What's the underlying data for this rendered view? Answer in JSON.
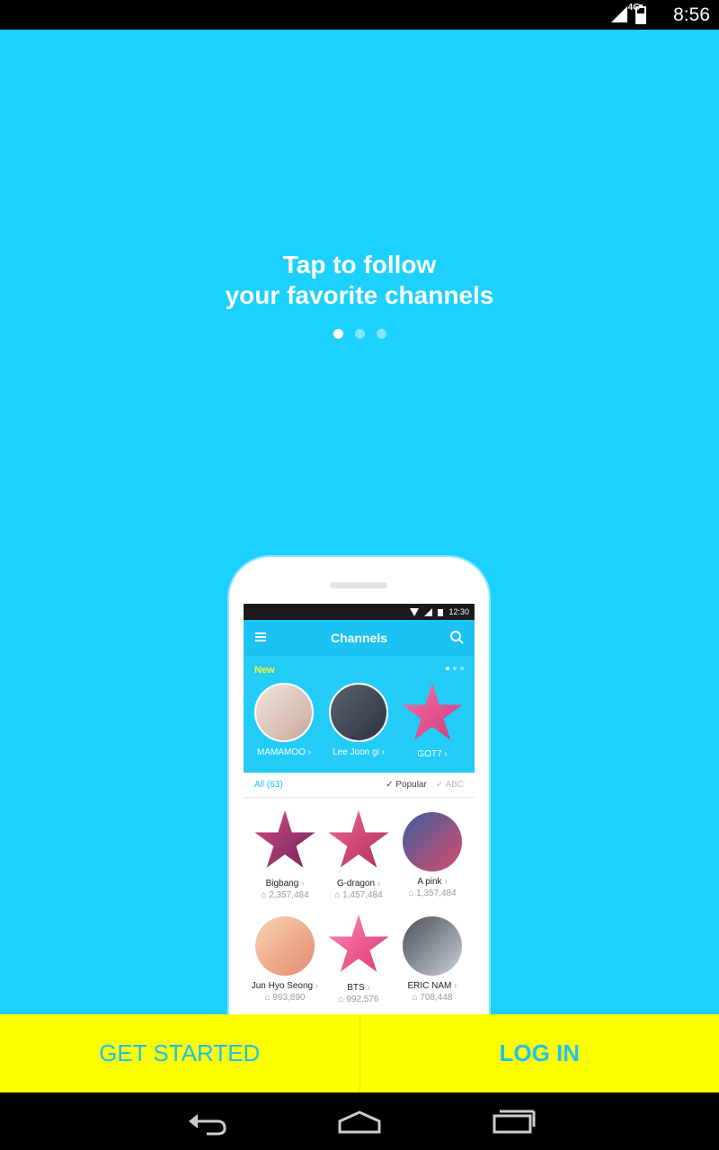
{
  "status_bar": {
    "network": "4G",
    "time": "8:56"
  },
  "headline": {
    "line1": "Tap to follow",
    "line2": "your favorite channels"
  },
  "pager": {
    "count": 3,
    "active": 0
  },
  "mockup": {
    "status_time": "12:30",
    "title": "Channels",
    "new_label": "New",
    "new_items": [
      {
        "name": "MAMAMOO"
      },
      {
        "name": "Lee Joon gi"
      },
      {
        "name": "GOT7"
      }
    ],
    "filter": {
      "all": "All (63)",
      "popular": "Popular",
      "abc": "ABC"
    },
    "channels": [
      {
        "name": "Bigbang",
        "followers": "2,357,484"
      },
      {
        "name": "G-dragon",
        "followers": "1,457,484"
      },
      {
        "name": "A pink",
        "followers": "1,357,484"
      },
      {
        "name": "Jun Hyo Seong",
        "followers": "993,890"
      },
      {
        "name": "BTS",
        "followers": "992,576"
      },
      {
        "name": "ERIC NAM",
        "followers": "708,448"
      }
    ]
  },
  "actions": {
    "get_started": "GET STARTED",
    "log_in": "LOG IN"
  },
  "colors": {
    "background": "#1cd1ff",
    "button_bar": "#ffff00",
    "button_text": "#1cc3f2"
  }
}
